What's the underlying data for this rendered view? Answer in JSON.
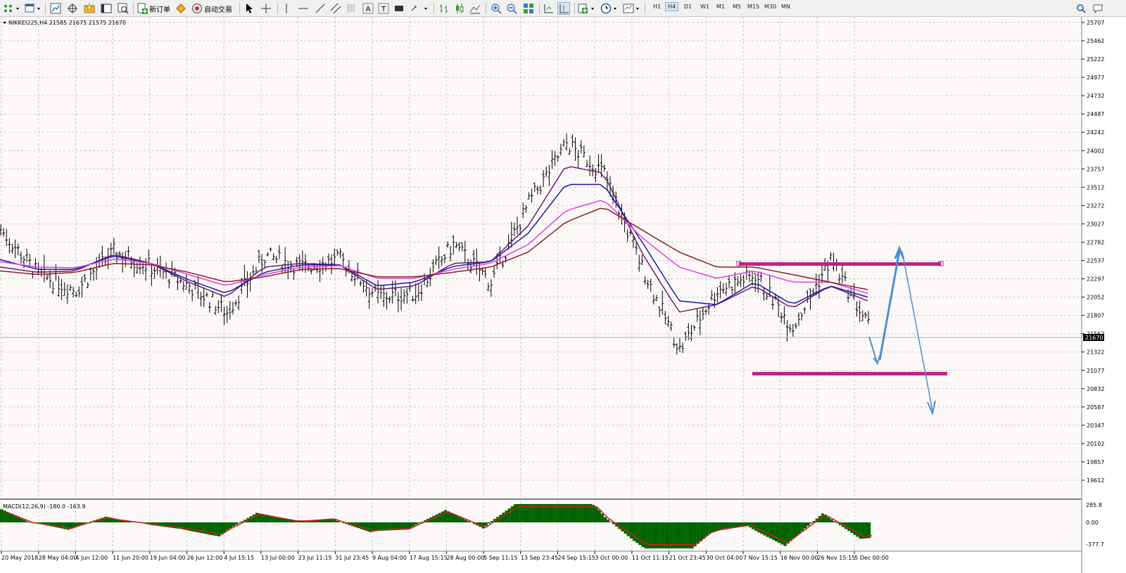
{
  "toolbar": {
    "new_order_label": "新订单",
    "auto_trading_label": "自动交易",
    "timeframes": [
      "H1",
      "H4",
      "D1",
      "W1",
      "M1",
      "M5",
      "M15",
      "M30",
      "MN"
    ]
  },
  "chart_header": {
    "symbol_line": "NIKKEI225,H4  21585 21675 21575 21670"
  },
  "price_axis": {
    "labels": [
      "25707",
      "25462",
      "25222",
      "24977",
      "24732",
      "24487",
      "24242",
      "24002",
      "23757",
      "23512",
      "23272",
      "23027",
      "22782",
      "22537",
      "22297",
      "22052",
      "21807",
      "21562",
      "21322",
      "21077",
      "20832",
      "20587",
      "20347",
      "20102",
      "19857",
      "19612"
    ],
    "current_price": "21670"
  },
  "macd_panel": {
    "title": "MACD(12,26,9) -180.0 -163.9",
    "labels": [
      "285.8",
      "0.00",
      "-377.7"
    ]
  },
  "time_axis": {
    "labels": [
      "20 May 2018",
      "28 May 04:00",
      "4 Jun 12:00",
      "11 Jun 20:00",
      "19 Jun 04:00",
      "26 Jun 12:00",
      "4 Jul 15:15",
      "13 Jul 00:00",
      "23 Jul 11:15",
      "31 Jul 23:45",
      "9 Aug 04:00",
      "17 Aug 15:15",
      "28 Aug 00:00",
      "5 Sep 11:15",
      "13 Sep 23:45",
      "24 Sep 15:15",
      "3 Oct 00:00",
      "11 Oct 11:15",
      "21 Oct 23:45",
      "30 Oct 04:00",
      "7 Nov 15:15",
      "16 Nov 00:00",
      "26 Nov 15:15",
      "5 Dec 00:00"
    ]
  },
  "chart_data": {
    "type": "line",
    "symbol": "NIKKEI225",
    "timeframe": "H4",
    "ylim": [
      19612,
      25707
    ],
    "grid": true,
    "x": [
      "20 May 2018",
      "28 May 04:00",
      "4 Jun 12:00",
      "11 Jun 20:00",
      "19 Jun 04:00",
      "26 Jun 12:00",
      "4 Jul 15:15",
      "13 Jul 00:00",
      "23 Jul 11:15",
      "31 Jul 23:45",
      "9 Aug 04:00",
      "17 Aug 15:15",
      "28 Aug 00:00",
      "5 Sep 11:15",
      "13 Sep 23:45",
      "24 Sep 15:15",
      "3 Oct 00:00",
      "11 Oct 11:15",
      "21 Oct 23:45",
      "30 Oct 04:00",
      "7 Nov 15:15",
      "16 Nov 00:00",
      "26 Nov 15:15",
      "5 Dec 00:00"
    ],
    "series": [
      {
        "values": [
          22950,
          22350,
          22150,
          22650,
          22450,
          22200,
          21850,
          22600,
          22450,
          22550,
          22050,
          22100,
          22750,
          22250,
          23300,
          24100,
          23700,
          22450,
          21350,
          22150,
          22350,
          21650,
          22550,
          21670
        ]
      },
      {
        "values": [
          22450,
          22380,
          22400,
          22620,
          22500,
          22250,
          22050,
          22450,
          22500,
          22480,
          22150,
          22200,
          22500,
          22520,
          23000,
          23800,
          23700,
          22650,
          21850,
          21950,
          22200,
          21900,
          22200,
          22000
        ]
      },
      {
        "values": [
          22550,
          22420,
          22420,
          22600,
          22500,
          22280,
          22100,
          22380,
          22480,
          22480,
          22200,
          22250,
          22460,
          22520,
          22900,
          23550,
          23550,
          22800,
          22000,
          21950,
          22250,
          21950,
          22200,
          22050
        ]
      },
      {
        "values": [
          22520,
          22450,
          22440,
          22560,
          22500,
          22350,
          22200,
          22350,
          22450,
          22470,
          22300,
          22300,
          22420,
          22500,
          22750,
          23200,
          23350,
          22850,
          22450,
          22300,
          22400,
          22250,
          22250,
          22100
        ]
      },
      {
        "values": [
          22400,
          22350,
          22380,
          22500,
          22480,
          22380,
          22250,
          22320,
          22420,
          22430,
          22320,
          22320,
          22380,
          22450,
          22650,
          23050,
          23250,
          22950,
          22650,
          22450,
          22450,
          22350,
          22250,
          22150
        ]
      }
    ],
    "horizontal_levels": [
      22600,
      21250
    ],
    "macd_ylim": [
      -377.7,
      285.8
    ]
  },
  "colors": {
    "chart_bg": "#fcf8f8",
    "grid": "#c8c8c8",
    "price": "#000000",
    "ma_fast": "#6b1a6b",
    "ma_blue": "#1a1aa8",
    "ma_magenta": "#e040e0",
    "ma_brown": "#8b2020",
    "level": "#c0208c",
    "arrow": "#4a90d0",
    "macd_hist": "#006400",
    "macd_signal": "#d02020"
  }
}
